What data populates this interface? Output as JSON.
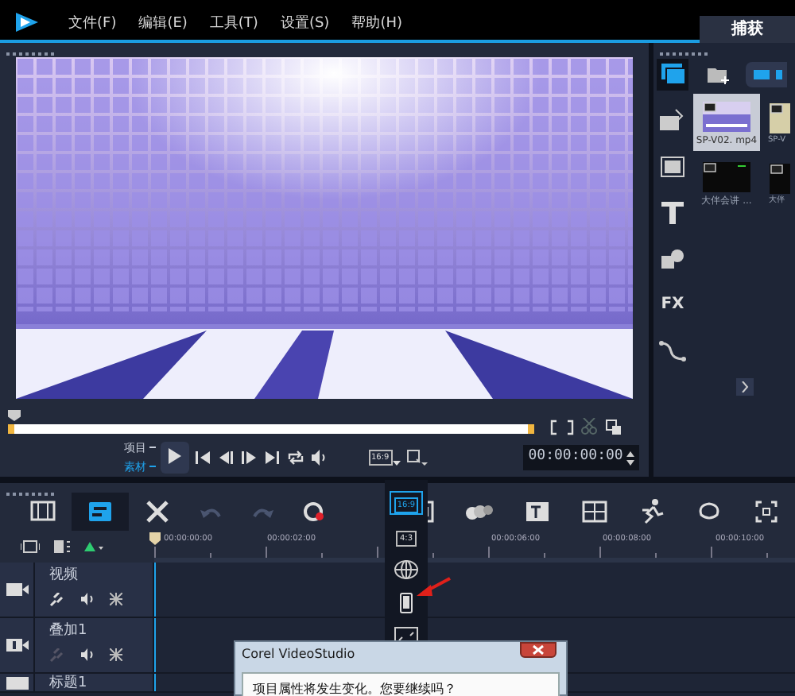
{
  "menu": [
    {
      "label": "文件(F)"
    },
    {
      "label": "编辑(E)"
    },
    {
      "label": "工具(T)"
    },
    {
      "label": "设置(S)"
    },
    {
      "label": "帮助(H)"
    }
  ],
  "tabs": [
    {
      "label": "捕获",
      "selected": true
    }
  ],
  "player": {
    "scrubber": {
      "level": 0
    },
    "modes": [
      {
        "label": "项目",
        "selected": false
      },
      {
        "label": "素材",
        "selected": true
      }
    ],
    "aspect": "16:9",
    "timecode": "00:00:00:00"
  },
  "library": {
    "tools": [
      {
        "kind": "media",
        "selected": true
      },
      {
        "kind": "instant",
        "selected": false
      },
      {
        "kind": "transition",
        "selected": false
      },
      {
        "kind": "title",
        "selected": false
      },
      {
        "kind": "graphic",
        "selected": false
      },
      {
        "kind": "fx",
        "label": "FX",
        "selected": false
      },
      {
        "kind": "path",
        "selected": false
      }
    ],
    "items": [
      {
        "label": "SP-V02. mp4",
        "kind": "video",
        "selected": true
      },
      {
        "label": "SP-V",
        "selected": false
      },
      {
        "label": "大伴会讲 ...",
        "kind": "dark",
        "selected": false
      },
      {
        "label": "大伴",
        "kind": "dark",
        "selected": false
      }
    ]
  },
  "timeline": {
    "view_modes": [
      {
        "kind": "storyboard",
        "selected": false
      },
      {
        "kind": "timeline",
        "selected": true
      }
    ],
    "edit_buttons": [
      {
        "kind": "undo",
        "disabled": true
      },
      {
        "kind": "redo",
        "disabled": true
      }
    ],
    "ruler": [
      "00:00:00:00",
      "00:00:02:00",
      "00:00:06:00",
      "00:00:08:00",
      "00:00:10:00"
    ],
    "tracks": [
      {
        "label": "视频",
        "kind": "video"
      },
      {
        "label": "叠加1",
        "kind": "overlay"
      },
      {
        "label": "标题1",
        "kind": "title"
      }
    ]
  },
  "aspect_menu": [
    {
      "kind": "text",
      "label": "16:9",
      "selected": true
    },
    {
      "kind": "text",
      "label": "4:3",
      "selected": false
    },
    {
      "kind": "globe",
      "selected": false
    },
    {
      "kind": "phone",
      "selected": false
    },
    {
      "kind": "resize",
      "selected": false
    }
  ],
  "dialog": {
    "title": "Corel VideoStudio",
    "message": "项目属性将发生变化。您要继续吗？"
  }
}
